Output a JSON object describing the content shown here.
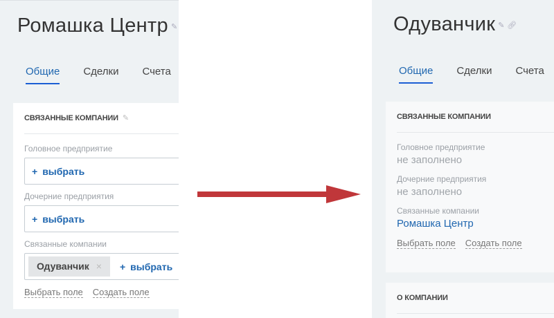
{
  "left": {
    "title": "Ромашка  Центр",
    "tabs": [
      "Общие",
      "Сделки",
      "Счета"
    ],
    "section_title": "Связанные компании",
    "fields": [
      {
        "label": "Головное предприятие",
        "action": "выбрать"
      },
      {
        "label": "Дочерние предприятия",
        "action": "выбрать"
      },
      {
        "label": "Связанные компании",
        "tag": "Одуванчик",
        "action": "выбрать"
      }
    ],
    "links": [
      "Выбрать поле",
      "Создать поле"
    ]
  },
  "right": {
    "title": "Одуванчик",
    "tabs": [
      "Общие",
      "Сделки",
      "Счета"
    ],
    "section_title": "Связанные компании",
    "fields": [
      {
        "label": "Головное предприятие",
        "value": "не заполнено"
      },
      {
        "label": "Дочерние предприятия",
        "value": "не заполнено"
      },
      {
        "label": "Связанные компании",
        "value": "Ромашка Центр"
      }
    ],
    "links": [
      "Выбрать поле",
      "Создать поле"
    ],
    "section2_title": "О компании"
  },
  "colors": {
    "accent": "#2067b0",
    "arrow": "#c0373a"
  }
}
